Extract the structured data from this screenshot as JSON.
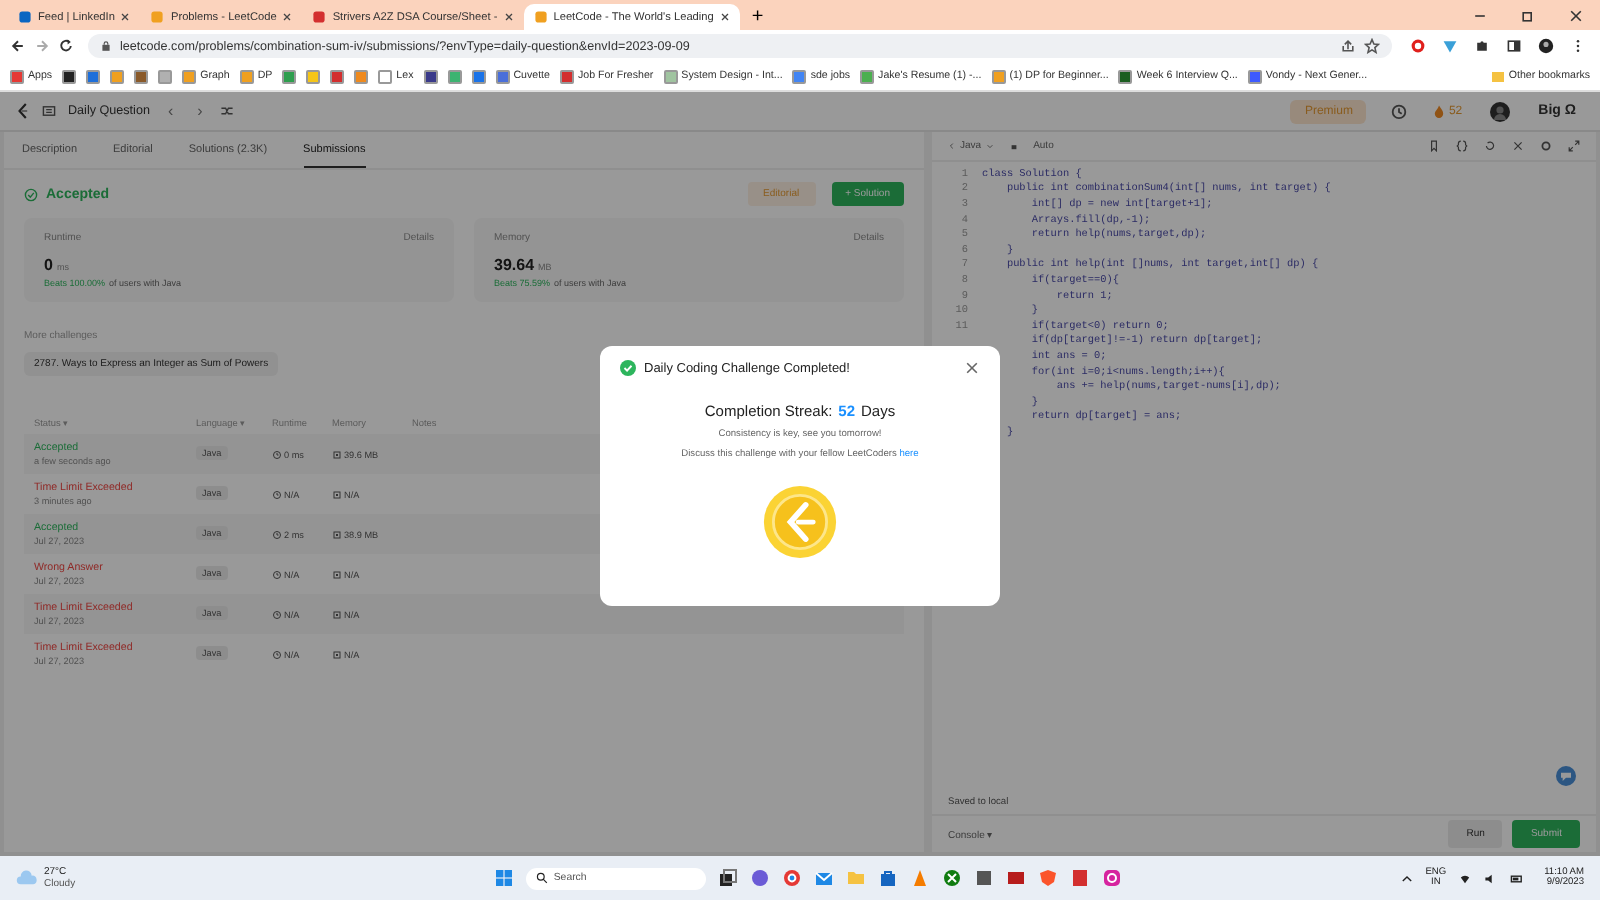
{
  "browser": {
    "tabs": [
      {
        "title": "Feed | LinkedIn",
        "color": "#0a66c2",
        "selected": false
      },
      {
        "title": "Problems - LeetCode",
        "color": "#f0a020",
        "selected": false
      },
      {
        "title": "Strivers A2Z DSA Course/Sheet -",
        "color": "#d32f2f",
        "selected": false
      },
      {
        "title": "LeetCode - The World's Leading",
        "color": "#f0a020",
        "selected": true
      }
    ],
    "new_tab": "+",
    "address": "leetcode.com/problems/combination-sum-iv/submissions/?envType=daily-question&envId=2023-09-09",
    "bookmarks": [
      {
        "label": "Apps",
        "color": "#e53935"
      },
      {
        "color": "#222222"
      },
      {
        "color": "#1e6fd9"
      },
      {
        "color": "#f0a020"
      },
      {
        "color": "#8a5a2a"
      },
      {
        "color": "#b0b0b0"
      },
      {
        "label": "Graph",
        "color": "#f0a020"
      },
      {
        "label": "DP",
        "color": "#f0a020"
      },
      {
        "color": "#2e9e4e"
      },
      {
        "color": "#f5c518"
      },
      {
        "color": "#d32f2f"
      },
      {
        "color": "#ef8a1e"
      },
      {
        "label": "Lex",
        "color": "#ffffff"
      },
      {
        "color": "#3a3a8a"
      },
      {
        "color": "#3cb371"
      },
      {
        "color": "#1a73e8"
      },
      {
        "label": "Cuvette",
        "color": "#4a6fd9"
      },
      {
        "label": "Job For Fresher",
        "color": "#d32f2f"
      },
      {
        "label": "System Design - Int...",
        "color": "#a0c4a0"
      },
      {
        "label": "sde jobs",
        "color": "#4285f4"
      },
      {
        "label": "Jake's Resume (1) -...",
        "color": "#4caf50"
      },
      {
        "label": "(1) DP for Beginner...",
        "color": "#f0a020"
      },
      {
        "label": "Week 6 Interview Q...",
        "color": "#1b5e20"
      },
      {
        "label": "Vondy - Next Gener...",
        "color": "#3d5afe"
      }
    ],
    "other_bookmarks": "Other bookmarks"
  },
  "header": {
    "title": "Daily Question",
    "prev": "‹",
    "next": "›",
    "premium": "Premium",
    "streak": "52",
    "user": "Big Ω"
  },
  "tabs": [
    {
      "label": "Description",
      "selected": false
    },
    {
      "label": "Editorial",
      "selected": false
    },
    {
      "label": "Solutions (2.3K)",
      "selected": false
    },
    {
      "label": "Submissions",
      "selected": true
    }
  ],
  "result": {
    "status": "Accepted",
    "editorial": "Editorial",
    "solution": "+ Solution",
    "cards": [
      {
        "title": "Runtime",
        "details": "Details",
        "value": "0",
        "unit": "ms",
        "beats": "Beats 100.00%",
        "rest": "of users with Java"
      },
      {
        "title": "Memory",
        "details": "Details",
        "value": "39.64",
        "unit": "MB",
        "beats": "Beats 75.59%",
        "rest": "of users with Java"
      }
    ]
  },
  "more": {
    "heading": "More challenges",
    "item": "2787. Ways to Express an Integer as Sum of Powers"
  },
  "submissions": {
    "columns": [
      "Status ▾",
      "Language ▾",
      "Runtime",
      "Memory",
      "Notes"
    ],
    "rows": [
      {
        "status": "Accepted",
        "kind": "accepted",
        "time": "a few seconds ago",
        "language": "Java",
        "runtime": "0 ms",
        "memory": "39.6 MB"
      },
      {
        "status": "Time Limit Exceeded",
        "kind": "error",
        "time": "3 minutes ago",
        "language": "Java",
        "runtime": "N/A",
        "memory": "N/A"
      },
      {
        "status": "Accepted",
        "kind": "accepted",
        "time": "Jul 27, 2023",
        "language": "Java",
        "runtime": "2 ms",
        "memory": "38.9 MB"
      },
      {
        "status": "Wrong Answer",
        "kind": "error",
        "time": "Jul 27, 2023",
        "language": "Java",
        "runtime": "N/A",
        "memory": "N/A"
      },
      {
        "status": "Time Limit Exceeded",
        "kind": "error",
        "time": "Jul 27, 2023",
        "language": "Java",
        "runtime": "N/A",
        "memory": "N/A"
      },
      {
        "status": "Time Limit Exceeded",
        "kind": "error",
        "time": "Jul 27, 2023",
        "language": "Java",
        "runtime": "N/A",
        "memory": "N/A"
      }
    ]
  },
  "editor": {
    "language": "Java",
    "mode": "Auto",
    "lines": [
      {
        "number": "1",
        "code": "class Solution {"
      },
      {
        "number": "2",
        "code": "    public int combinationSum4(int[] nums, int target) {"
      },
      {
        "number": "3",
        "code": "        int[] dp = new int[target+1];"
      },
      {
        "number": "4",
        "code": "        Arrays.fill(dp,-1);"
      },
      {
        "number": "5",
        "code": "        return help(nums,target,dp);"
      },
      {
        "number": "6",
        "code": "    }"
      },
      {
        "number": "7",
        "code": "    public int help(int []nums, int target,int[] dp) {"
      },
      {
        "number": "8",
        "code": "        if(target==0){"
      },
      {
        "number": "9",
        "code": "            return 1;"
      },
      {
        "number": "10",
        "code": "        }"
      },
      {
        "number": "11",
        "code": "        if(target<0) return 0;"
      },
      {
        "code": "        if(dp[target]!=-1) return dp[target];"
      },
      {
        "code": "        int ans = 0;"
      },
      {
        "code": "        for(int i=0;i<nums.length;i++){"
      },
      {
        "code": "            ans += help(nums,target-nums[i],dp);"
      },
      {
        "code": "        }"
      },
      {
        "code": "        return dp[target] = ans;"
      },
      {
        "code": "    }"
      }
    ],
    "saved": "Saved to local",
    "console": "Console ▾",
    "run": "Run",
    "submit": "Submit"
  },
  "modal": {
    "title": "Daily Coding Challenge Completed!",
    "streak_label": "Completion Streak:",
    "streak": "52",
    "streak_unit": "Days",
    "note": "Consistency is key, see you tomorrow!",
    "discuss": "Discuss this challenge with your fellow LeetCoders",
    "link": "here"
  },
  "taskbar": {
    "temperature": "27°C",
    "weather": "Cloudy",
    "search": "Search",
    "language": "ENG",
    "region": "IN",
    "time": "11:10 AM",
    "date": "9/9/2023"
  }
}
